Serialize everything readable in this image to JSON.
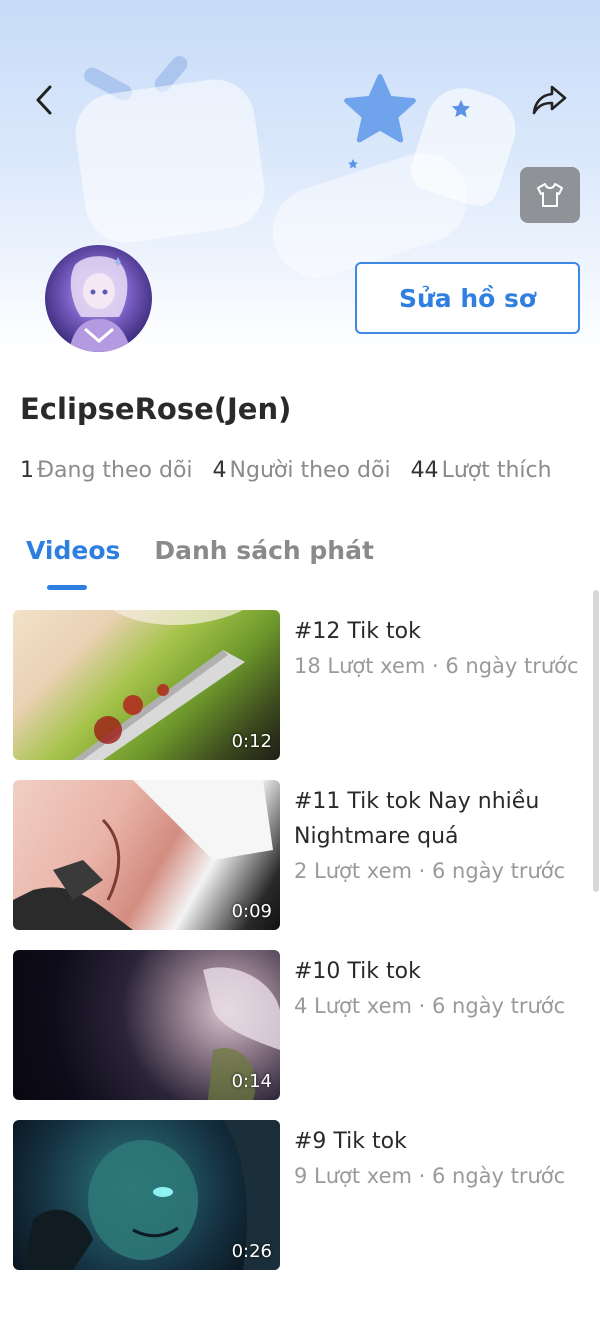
{
  "header": {
    "back_icon": "chevron-left-icon",
    "share_icon": "share-arrow-icon",
    "theme_icon": "tshirt-icon"
  },
  "profile": {
    "edit_label": "Sửa hồ sơ",
    "username": "EclipseRose(Jen)",
    "stats": [
      {
        "value": "1",
        "label": "Đang theo dõi"
      },
      {
        "value": "4",
        "label": "Người theo dõi"
      },
      {
        "value": "44",
        "label": "Lượt thích"
      }
    ]
  },
  "tabs": [
    {
      "label": "Videos",
      "active": true
    },
    {
      "label": "Danh sách phát",
      "active": false
    }
  ],
  "videos": [
    {
      "title": "#12 Tik tok",
      "meta": "18 Lượt xem · 6 ngày trước",
      "duration": "0:12"
    },
    {
      "title": "#11 Tik tok Nay nhiều Nightmare quá",
      "meta": "2 Lượt xem · 6 ngày trước",
      "duration": "0:09"
    },
    {
      "title": "#10 Tik tok",
      "meta": "4 Lượt xem · 6 ngày trước",
      "duration": "0:14"
    },
    {
      "title": "#9 Tik tok",
      "meta": "9 Lượt xem · 6 ngày trước",
      "duration": "0:26"
    }
  ],
  "colors": {
    "accent": "#2f7fe0",
    "secondary_text": "#8b8b8b"
  }
}
